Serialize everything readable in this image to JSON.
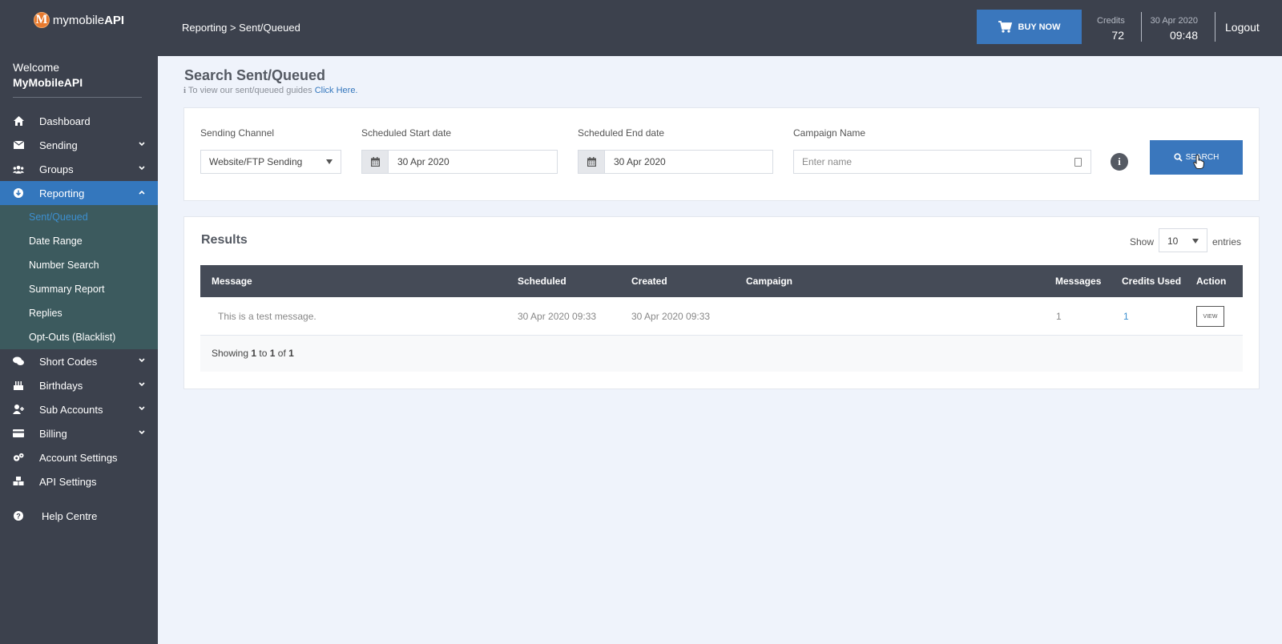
{
  "brand": {
    "logo_letter": "M",
    "name_light": "mymobile",
    "name_bold": "API"
  },
  "welcome": {
    "greeting": "Welcome",
    "user": "MyMobileAPI"
  },
  "sidebar": {
    "items": [
      {
        "label": "Dashboard",
        "icon": "home-icon"
      },
      {
        "label": "Sending",
        "icon": "envelope-icon"
      },
      {
        "label": "Groups",
        "icon": "users-icon"
      },
      {
        "label": "Reporting",
        "icon": "download-icon"
      },
      {
        "label": "Short Codes",
        "icon": "chat-icon"
      },
      {
        "label": "Birthdays",
        "icon": "cake-icon"
      },
      {
        "label": "Sub Accounts",
        "icon": "user-plus-icon"
      },
      {
        "label": "Billing",
        "icon": "credit-card-icon"
      },
      {
        "label": "Account Settings",
        "icon": "cogs-icon"
      },
      {
        "label": "API Settings",
        "icon": "cubes-icon"
      },
      {
        "label": "Help Centre",
        "icon": "question-icon"
      }
    ],
    "reporting_sub": [
      "Sent/Queued",
      "Date Range",
      "Number Search",
      "Summary Report",
      "Replies",
      "Opt-Outs (Blacklist)"
    ]
  },
  "header": {
    "breadcrumb": "Reporting > Sent/Queued",
    "buy_label": "BUY NOW",
    "credits_label": "Credits",
    "credits_value": "72",
    "date": "30 Apr 2020",
    "time": "09:48",
    "logout": "Logout"
  },
  "page": {
    "title": "Search Sent/Queued",
    "guide_text": "To view our sent/queued guides",
    "guide_link": "Click Here."
  },
  "filters": {
    "channel_label": "Sending Channel",
    "channel_value": "Website/FTP Sending",
    "start_label": "Scheduled Start date",
    "start_value": "30 Apr 2020",
    "end_label": "Scheduled End date",
    "end_value": "30 Apr 2020",
    "campaign_label": "Campaign Name",
    "campaign_placeholder": "Enter name",
    "search_label": "SEARCH"
  },
  "results": {
    "title": "Results",
    "show_label": "Show",
    "entries_value": "10",
    "entries_label": "entries",
    "columns": [
      "Message",
      "Scheduled",
      "Created",
      "Campaign",
      "Messages",
      "Credits Used",
      "Action"
    ],
    "rows": [
      {
        "message": "This is a test message.",
        "scheduled": "30 Apr 2020 09:33",
        "created": "30 Apr 2020 09:33",
        "campaign": "",
        "messages": "1",
        "credits": "1",
        "action": "VIEW"
      }
    ],
    "footer": {
      "prefix": "Showing",
      "from": "1",
      "to_word": "to",
      "to": "1",
      "of_word": "of",
      "total": "1"
    }
  }
}
